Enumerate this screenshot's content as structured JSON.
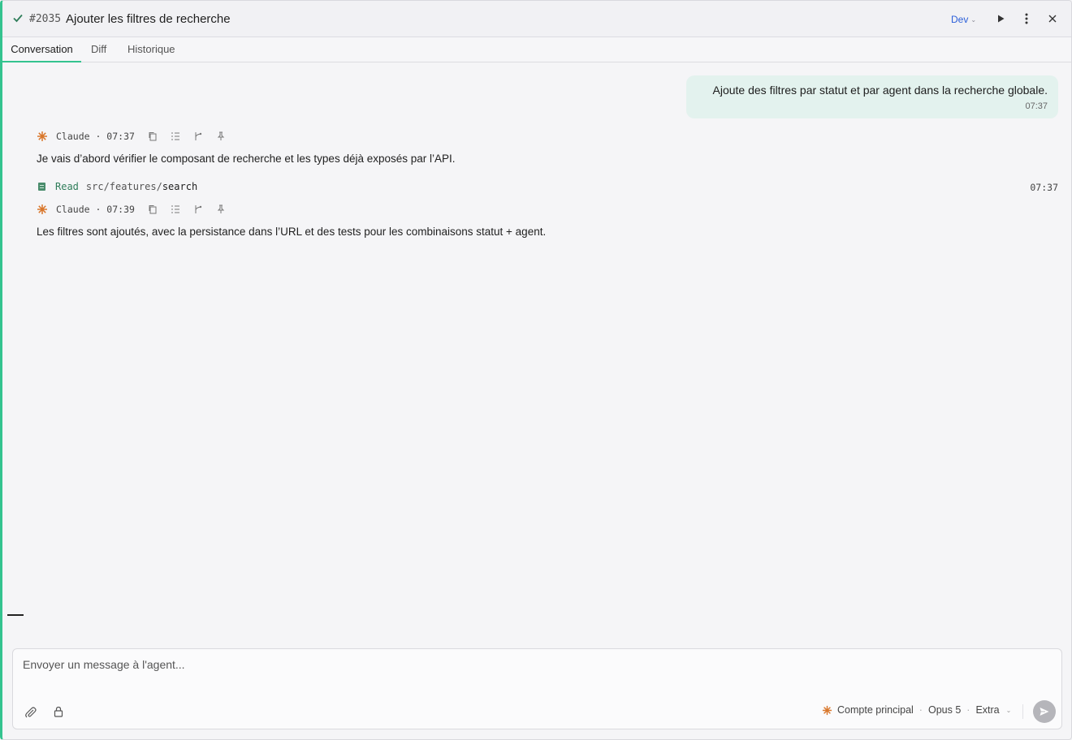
{
  "header": {
    "issue_number": "#2035",
    "title": "Ajouter les filtres de recherche",
    "env_label": "Dev",
    "check_icon": "check-icon",
    "accent_color": "#34c38f"
  },
  "tabs": [
    {
      "label": "Conversation",
      "active": true
    },
    {
      "label": "Diff",
      "active": false
    },
    {
      "label": "Historique",
      "active": false
    }
  ],
  "messages": {
    "user": {
      "text": "Ajoute des filtres par statut et par agent dans la recherche globale.",
      "time": "07:37"
    },
    "assistant_1": {
      "meta": "Claude · 07:37",
      "text": "Je vais d’abord vérifier le composant de recherche et les types déjà exposés par l’API."
    },
    "tool": {
      "verb": "Read",
      "path_prefix": "src/features/",
      "path_leaf": "search",
      "time": "07:37"
    },
    "assistant_2": {
      "meta": "Claude · 07:39",
      "text": "Les filtres sont ajoutés, avec la persistance dans l’URL et des tests pour les combinaisons statut + agent."
    }
  },
  "composer": {
    "placeholder": "Envoyer un message à l'agent...",
    "account": "Compte principal",
    "model": "Opus 5",
    "mode": "Extra"
  }
}
